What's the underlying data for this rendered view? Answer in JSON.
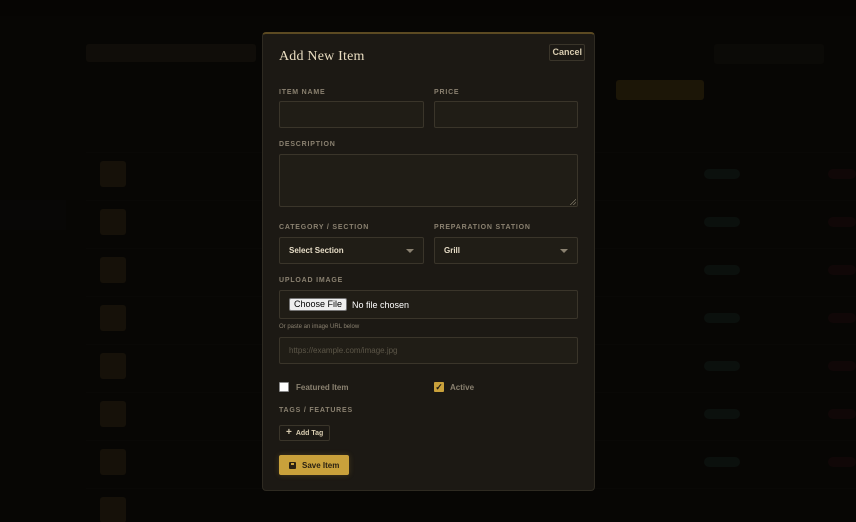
{
  "modal": {
    "title": "Add New Item",
    "cancel_label": "Cancel",
    "fields": {
      "item_name": {
        "label": "ITEM NAME",
        "value": ""
      },
      "price": {
        "label": "PRICE",
        "value": ""
      },
      "description": {
        "label": "DESCRIPTION",
        "value": ""
      },
      "category": {
        "label": "CATEGORY / SECTION",
        "selected": "Select Section"
      },
      "station": {
        "label": "PREPARATION STATION",
        "selected": "Grill"
      },
      "upload": {
        "label": "UPLOAD IMAGE",
        "choose_label": "Choose File",
        "file_status": "No file chosen",
        "hint": "Or paste an image URL below",
        "url_placeholder": "https://example.com/image.jpg"
      }
    },
    "featured": {
      "label": "Featured Item",
      "checked": false
    },
    "active": {
      "label": "Active",
      "checked": true
    },
    "tags": {
      "label": "TAGS / FEATURES",
      "add_label": "Add Tag"
    },
    "save_label": "Save Item"
  },
  "colors": {
    "accent": "#c9a13b",
    "modal_bg": "#1c1914",
    "label": "#8a8170"
  }
}
